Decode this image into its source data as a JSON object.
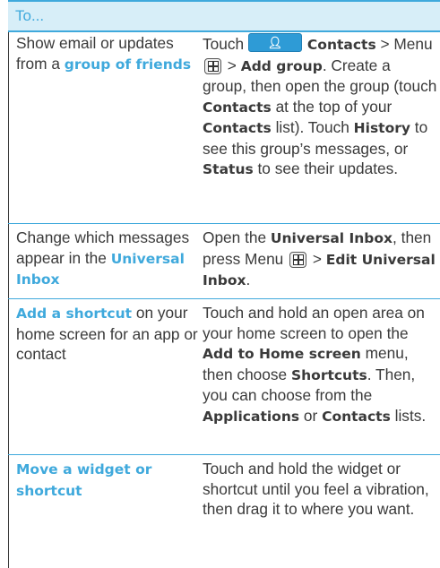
{
  "header": {
    "label": "To..."
  },
  "rows": [
    {
      "task_pre": "Show email or updates from a ",
      "task_link": "group of friends",
      "steps": {
        "t1": "Touch ",
        "contacts_key": "",
        "contacts": "Contacts",
        "gt1": " > ",
        "menu": "Menu ",
        "gt2": " > ",
        "add_group": "Add group",
        "t2": ". Create a group, then open the group (touch ",
        "contacts2": "Contacts",
        "t3": " at the top of your ",
        "contacts3": "Contacts",
        "t4": " list). Touch ",
        "history": "History",
        "t5": " to see this group’s messages, or ",
        "status": "Status",
        "t6": " to see their updates."
      }
    },
    {
      "task_pre": "Change which messages appear in the ",
      "task_link": "Universal Inbox",
      "steps": {
        "t1": "Open the ",
        "universal_inbox": "Universal Inbox",
        "t2": ", then press Menu ",
        "gt": " > ",
        "edit": "Edit Universal Inbox",
        "t3": "."
      }
    },
    {
      "task_link": "Add a shortcut",
      "task_post": " on your home screen for an app or contact",
      "steps": {
        "t1": "Touch and hold an open area on your home screen to open the ",
        "add_home": "Add to Home screen",
        "t2": " menu, then choose ",
        "shortcuts": "Shortcuts",
        "t3": ". Then, you can choose from the ",
        "applications": "Applications",
        "t4": " or ",
        "contacts": "Contacts",
        "t5": " lists."
      }
    },
    {
      "task_link": "Move a widget or shortcut",
      "steps": {
        "t1": "Touch and hold the widget or shortcut until you feel a vibration, then drag it to where you want."
      }
    }
  ],
  "colors": {
    "accent": "#3fa9dc",
    "header_bg": "#d7eef8",
    "text": "#3a3a3a"
  },
  "icons": {
    "contacts_key": "contacts-person-icon",
    "menu_key": "menu-key-icon"
  }
}
